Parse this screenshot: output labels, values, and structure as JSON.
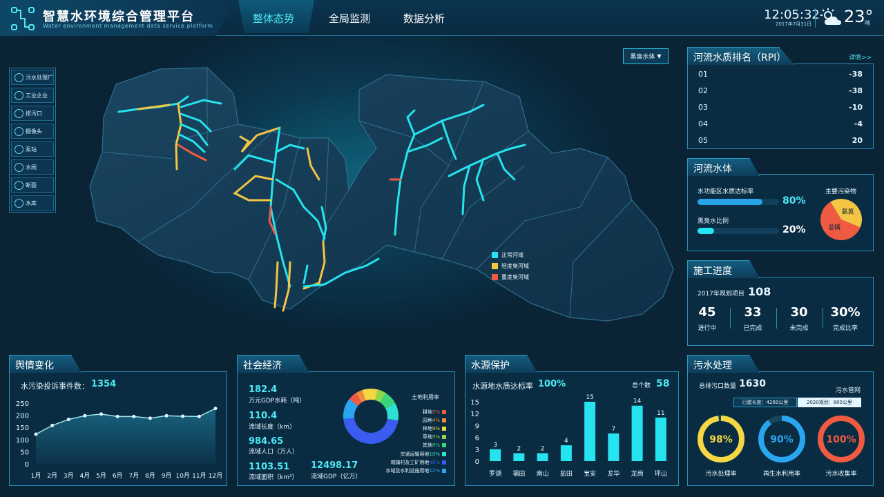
{
  "header": {
    "title": "智慧水环境综合管理平台",
    "subtitle": "Water environment management data service platform",
    "nav": [
      "整体态势",
      "全局监测",
      "数据分析"
    ],
    "time": "12:05:32",
    "date": "2017年7月31日",
    "temperature": "23°",
    "weather": "晴"
  },
  "left_legend": [
    "污水处理厂",
    "工业企业",
    "排污口",
    "摄像头",
    "泵站",
    "水闸",
    "断面",
    "水库"
  ],
  "map": {
    "dropdown": "黑臭水体",
    "legend": [
      {
        "label": "正常河域",
        "color": "#25e3ef"
      },
      {
        "label": "轻度臭河域",
        "color": "#f4c542"
      },
      {
        "label": "重度臭河域",
        "color": "#ef5a42"
      }
    ]
  },
  "rpi": {
    "title": "河流水质排名（RPI）",
    "detail": "详情>>",
    "rows": [
      {
        "rank": "01",
        "value": "-38"
      },
      {
        "rank": "02",
        "value": "-38"
      },
      {
        "rank": "03",
        "value": "-10"
      },
      {
        "rank": "04",
        "value": "-4"
      },
      {
        "rank": "05",
        "value": "20"
      }
    ]
  },
  "river": {
    "title": "河流水体",
    "rate_label": "水功能区水质达标率",
    "rate_value": "80%",
    "rate": 0.8,
    "black_label": "黑臭水比例",
    "black_value": "20%",
    "black": 0.2,
    "pollutant_title": "主要污染物",
    "pollutants": [
      {
        "label": "氨氮",
        "value": 0.4,
        "color": "#f4c542"
      },
      {
        "label": "总磷",
        "value": 0.6,
        "color": "#ef5a42"
      }
    ]
  },
  "construction": {
    "title": "施工进度",
    "project_label": "2017年规划项目",
    "project_value": "108",
    "stats": [
      {
        "value": "45",
        "label": "进行中"
      },
      {
        "value": "33",
        "label": "已完成"
      },
      {
        "value": "30",
        "label": "未完成"
      },
      {
        "value": "30%",
        "label": "完成比率"
      }
    ]
  },
  "opinion": {
    "title": "舆情变化",
    "count_label": "水污染投诉事件数：",
    "count_value": "1354",
    "chart_data": {
      "type": "line",
      "categories": [
        "1月",
        "2月",
        "3月",
        "4月",
        "5月",
        "6月",
        "7月",
        "8月",
        "9月",
        "10月",
        "11月",
        "12月"
      ],
      "values": [
        122,
        158,
        183,
        198,
        205,
        195,
        195,
        188,
        198,
        196,
        195,
        228
      ],
      "ylim": [
        0,
        250
      ],
      "yticks": [
        0,
        50,
        100,
        150,
        200,
        250
      ]
    }
  },
  "economy": {
    "title": "社会经济",
    "items": [
      {
        "value": "182.4",
        "label": "万元GDP水耗（吨）"
      },
      {
        "value": "110.4",
        "label": "流域长度（km）"
      },
      {
        "value": "984.65",
        "label": "流域人口（万人）"
      },
      {
        "value": "1103.51",
        "label": "流域面积（km²）"
      },
      {
        "value": "12498.17",
        "label": "流域GDP（亿万）"
      }
    ],
    "landuse_title": "土地利用率",
    "chart_data": {
      "type": "pie",
      "slices": [
        {
          "label": "耕地",
          "pct": "5%",
          "value": 5,
          "color": "#ef5a42"
        },
        {
          "label": "园地",
          "pct": "4%",
          "value": 4,
          "color": "#f08a3c"
        },
        {
          "label": "林地",
          "pct": "9%",
          "value": 9,
          "color": "#f4d742"
        },
        {
          "label": "草地",
          "pct": "5%",
          "value": 5,
          "color": "#8ed84a"
        },
        {
          "label": "其他",
          "pct": "8%",
          "value": 8,
          "color": "#39d57a"
        },
        {
          "label": "交通运输用地",
          "pct": "10%",
          "value": 10,
          "color": "#2de0d0"
        },
        {
          "label": "城镇村及工矿用地",
          "pct": "45%",
          "value": 45,
          "color": "#3a5cf0"
        },
        {
          "label": "水域及水利设施用地",
          "pct": "12%",
          "value": 12,
          "color": "#2aa6f0"
        }
      ]
    }
  },
  "source": {
    "title": "水源保护",
    "rate_label": "水源地水质达标率",
    "rate_value": "100%",
    "total_label": "总个数",
    "total_value": "58",
    "chart_data": {
      "type": "bar",
      "categories": [
        "罗湖",
        "福田",
        "南山",
        "盐田",
        "宝安",
        "龙华",
        "龙岗",
        "坪山"
      ],
      "values": [
        3,
        2,
        2,
        4,
        15,
        7,
        14,
        11
      ],
      "ylim": [
        0,
        15
      ],
      "yticks": [
        0,
        3,
        6,
        9,
        12,
        15
      ]
    }
  },
  "sewage": {
    "title": "污水处理",
    "outlet_label": "总排污口数量",
    "outlet_value": "1630",
    "network_label": "污水管网",
    "built": "已建长度：4260公里",
    "plan": "2020规划：800公里",
    "rings": [
      {
        "value": "98%",
        "pct": 0.98,
        "label": "污水处理率",
        "color": "#f4d742"
      },
      {
        "value": "90%",
        "pct": 0.9,
        "label": "再生水利用率",
        "color": "#2aa6f0"
      },
      {
        "value": "100%",
        "pct": 1.0,
        "label": "污水收集率",
        "color": "#ef5a42"
      }
    ]
  }
}
